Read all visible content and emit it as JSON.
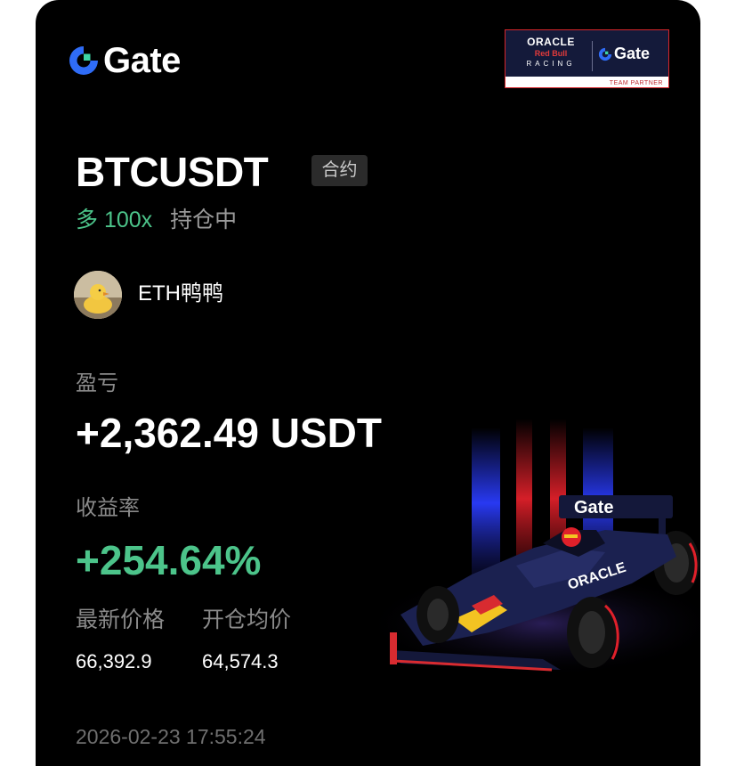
{
  "brand": {
    "name": "Gate",
    "logo_icon": "gate-logo-icon",
    "accent": "#2f6cf6",
    "accent_secondary": "#3ed6a6"
  },
  "partner": {
    "team_line1": "ORACLE",
    "team_line2": "Red Bull",
    "team_line3": "RACING",
    "sponsor": "Gate",
    "tag": "TEAM PARTNER"
  },
  "position": {
    "symbol": "BTCUSDT",
    "type_badge": "合约",
    "side": "多 100x",
    "status": "持仓中"
  },
  "user": {
    "name": "ETH鸭鸭",
    "avatar_icon": "duck-avatar"
  },
  "pnl": {
    "label": "盈亏",
    "value": "+2,362.49 USDT"
  },
  "roi": {
    "label": "收益率",
    "value": "+254.64%"
  },
  "prices": {
    "last_label": "最新价格",
    "last_value": "66,392.9",
    "entry_label": "开仓均价",
    "entry_value": "64,574.3"
  },
  "timestamp": "2026-02-23 17:55:24",
  "car": {
    "wing_text": "Gate",
    "side_text": "ORACLE"
  },
  "colors": {
    "background": "#000000",
    "positive": "#4cc48a",
    "muted": "#8a8a8a",
    "text": "#ffffff"
  }
}
